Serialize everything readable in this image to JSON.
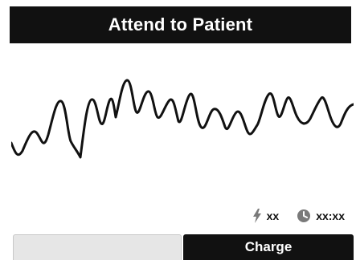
{
  "header": {
    "title": "Attend to Patient"
  },
  "status": {
    "shocks_label": "xx",
    "time_label": "xx:xx",
    "shocks_icon": "lightning-bolt-icon",
    "time_icon": "clock-icon"
  },
  "softkeys": {
    "left_label": "",
    "right_label": "Charge"
  },
  "colors": {
    "title_bar": "#111111",
    "waveform": "#111111",
    "left_softkey": "#e6e6e6",
    "right_softkey": "#111111"
  }
}
